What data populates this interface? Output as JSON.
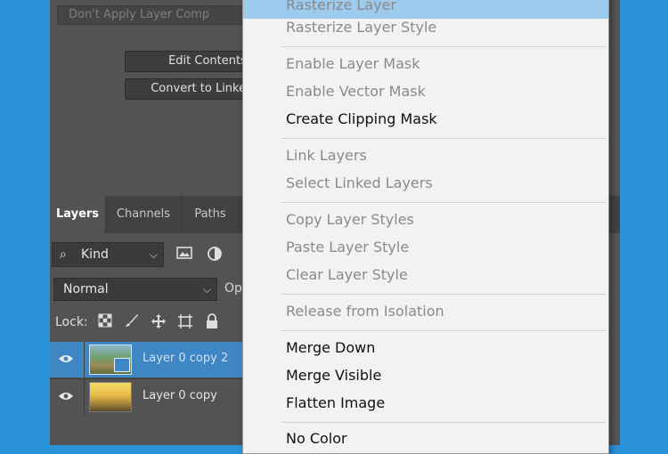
{
  "properties": {
    "layer_comp": "Don't Apply Layer Comp",
    "edit_contents": "Edit Contents",
    "convert_to_linked": "Convert to Linked..."
  },
  "tabs": [
    "Layers",
    "Channels",
    "Paths"
  ],
  "filter": {
    "kind_label": "Kind",
    "icons": [
      "image-filter-icon",
      "adjustment-filter-icon"
    ]
  },
  "blend_mode": {
    "value": "Normal",
    "opacity_label": "Op"
  },
  "lock": {
    "label": "Lock:",
    "icons": [
      "lock-transparent-pixels-icon",
      "lock-image-pixels-icon",
      "lock-position-icon",
      "lock-artboard-icon",
      "lock-all-icon"
    ]
  },
  "layers": [
    {
      "name": "Layer 0 copy 2",
      "selected": true
    },
    {
      "name": "Layer 0 copy",
      "selected": false
    }
  ],
  "menu": {
    "items": [
      {
        "label": "Rasterize Layer",
        "enabled": false,
        "highlighted": true
      },
      {
        "label": "Rasterize Layer Style",
        "enabled": false
      },
      {
        "label": "Enable Layer Mask",
        "enabled": false
      },
      {
        "label": "Enable Vector Mask",
        "enabled": false
      },
      {
        "label": "Create Clipping Mask",
        "enabled": true
      },
      {
        "label": "Link Layers",
        "enabled": false
      },
      {
        "label": "Select Linked Layers",
        "enabled": false
      },
      {
        "label": "Copy Layer Styles",
        "enabled": false
      },
      {
        "label": "Paste Layer Style",
        "enabled": false
      },
      {
        "label": "Clear Layer Style",
        "enabled": false
      },
      {
        "label": "Release from Isolation",
        "enabled": false
      },
      {
        "label": "Merge Down",
        "enabled": true
      },
      {
        "label": "Merge Visible",
        "enabled": true
      },
      {
        "label": "Flatten Image",
        "enabled": true
      },
      {
        "label": "No Color",
        "enabled": true
      }
    ]
  },
  "colors": {
    "background": "#2a92d8",
    "panel": "#535353",
    "selection": "#3f86c4",
    "menu_highlight": "#9ccbee"
  }
}
